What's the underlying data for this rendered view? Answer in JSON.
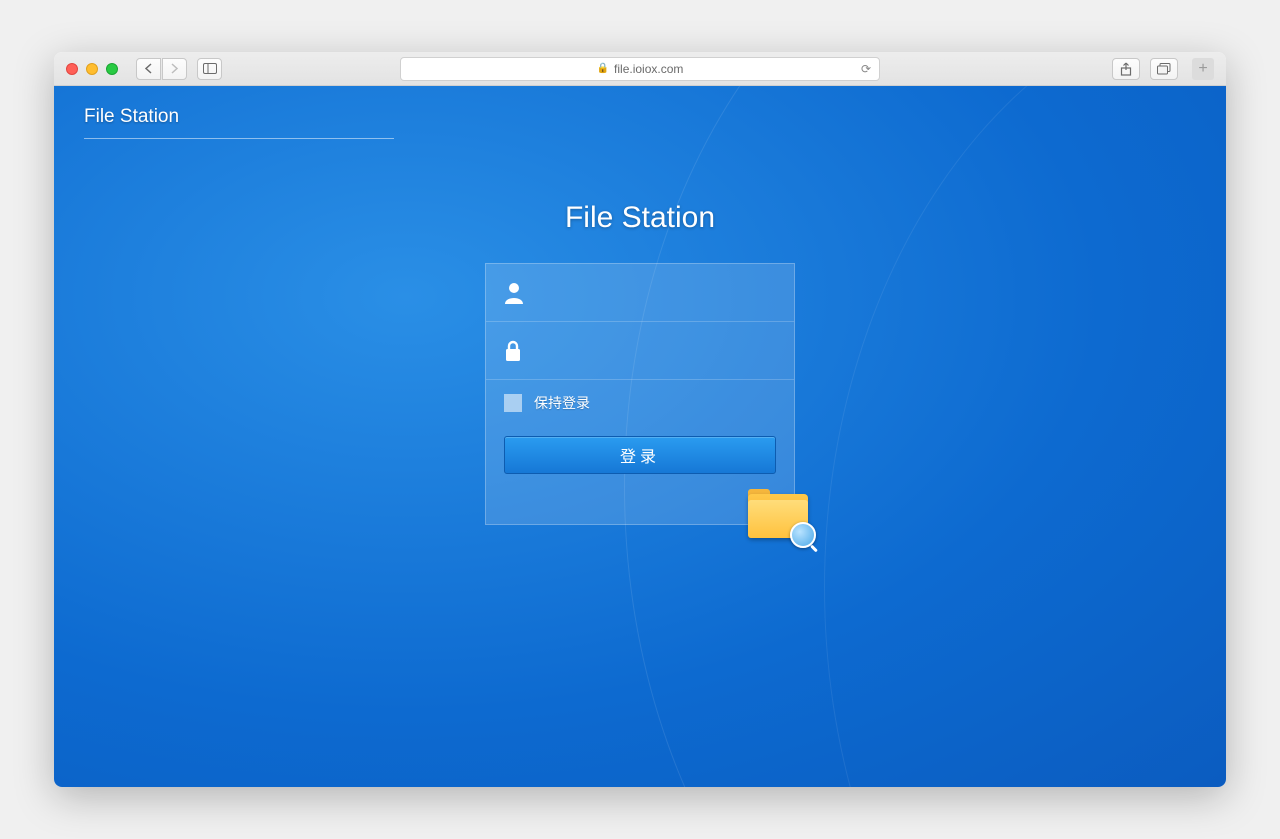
{
  "browser": {
    "url": "file.ioiox.com"
  },
  "brand": "File Station",
  "login": {
    "title": "File Station",
    "username_placeholder": "",
    "password_placeholder": "",
    "remember_label": "保持登录",
    "submit_label": "登录"
  }
}
